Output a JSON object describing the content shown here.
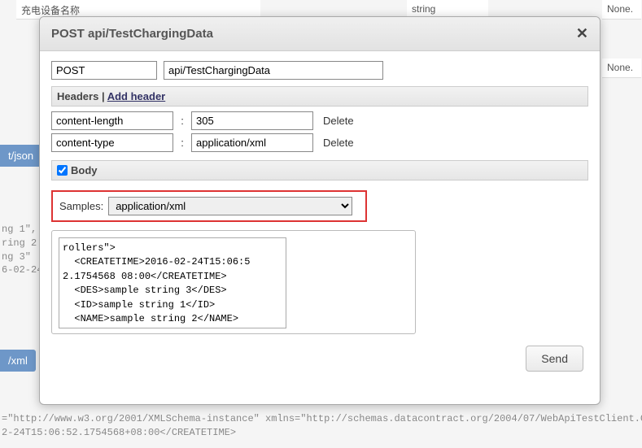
{
  "background": {
    "row0_label": "充电设备名称",
    "row0_type": "string",
    "row0_none": "None.",
    "row1_none": "None.",
    "sidebar_json": "t/json",
    "sidebar_xml": "/xml",
    "code_block": "ng 1\",\nring 2\nng 3\"\n6-02-24",
    "footer": "=\"http://www.w3.org/2001/XMLSchema-instance\" xmlns=\"http://schemas.datacontract.org/2004/07/WebApiTestClient.Co\n2-24T15:06:52.1754568+08:00</CREATETIME>"
  },
  "modal": {
    "title": "POST api/TestChargingData",
    "method": "POST",
    "url": "api/TestChargingData",
    "headers_label": "Headers",
    "add_header": "Add header",
    "headers": [
      {
        "name": "content-length",
        "value": "305",
        "delete": "Delete"
      },
      {
        "name": "content-type",
        "value": "application/xml",
        "delete": "Delete"
      }
    ],
    "body_label": "Body",
    "body_checked": true,
    "samples_label": "Samples:",
    "samples_selected": "application/xml",
    "body_text": "rollers\">\n  <CREATETIME>2016-02-24T15:06:5\n2.1754568 08:00</CREATETIME>\n  <DES>sample string 3</DES>\n  <ID>sample string 1</ID>\n  <NAME>sample string 2</NAME>",
    "send": "Send"
  }
}
